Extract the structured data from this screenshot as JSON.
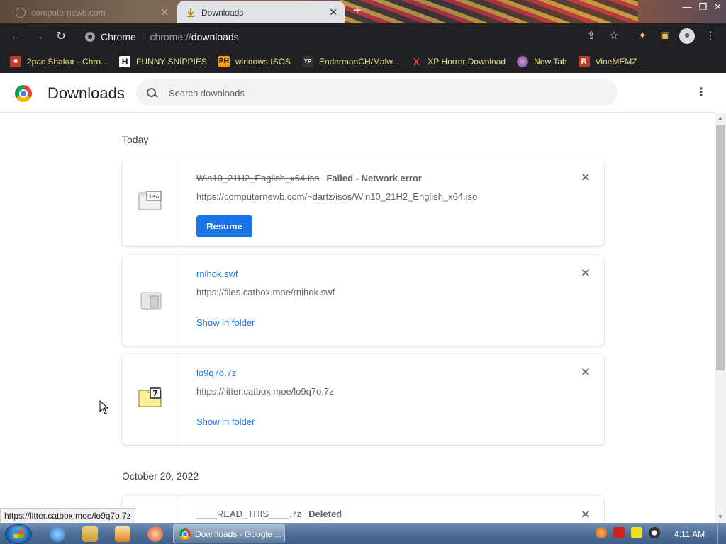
{
  "tabs": [
    {
      "title": "computernewb.com",
      "active": false
    },
    {
      "title": "Downloads",
      "active": true
    }
  ],
  "toolbar": {
    "omnibox_label": "Chrome",
    "url_host": "chrome://",
    "url_path": "downloads"
  },
  "bookmarks": [
    {
      "label": "2pac Shakur - Chro...",
      "icon": "briefcase-icon",
      "icon_text": "",
      "color": "#c0392b"
    },
    {
      "label": "FUNNY SNIPPIES",
      "icon": "h-logo-icon",
      "icon_text": "H",
      "color": "#ffffff"
    },
    {
      "label": "windows ISOS",
      "icon": "ph-logo-icon",
      "icon_text": "PH",
      "color": "#f39c12"
    },
    {
      "label": "EndermanCH/Malw...",
      "icon": "yp-logo-icon",
      "icon_text": "YP",
      "color": "#333333"
    },
    {
      "label": "XP Horror Download",
      "icon": "x-logo-icon",
      "icon_text": "X",
      "color": "#e74c3c"
    },
    {
      "label": "New Tab",
      "icon": "globe-icon",
      "icon_text": "",
      "color": "#9b59b6"
    },
    {
      "label": "VineMEMZ",
      "icon": "r-logo-icon",
      "icon_text": "R",
      "color": "#c0392b"
    }
  ],
  "header": {
    "title": "Downloads",
    "search_placeholder": "Search downloads"
  },
  "sections": [
    {
      "label": "Today"
    },
    {
      "label": "October 20, 2022"
    }
  ],
  "downloads": [
    {
      "filename": "Win10_21H2_English_x64.iso",
      "status": "Failed - Network error",
      "url": "https://computernewb.com/~dartz/isos/Win10_21H2_English_x64.iso",
      "action": "Resume"
    },
    {
      "filename": "rnihok.swf",
      "url": "https://files.catbox.moe/rnihok.swf",
      "action": "Show in folder"
    },
    {
      "filename": "lo9q7o.7z",
      "url": "https://litter.catbox.moe/lo9q7o.7z",
      "action": "Show in folder"
    },
    {
      "filename": "____READ_THIS____.7z",
      "status": "Deleted"
    }
  ],
  "status_bubble": "https://litter.catbox.moe/lo9q7o.7z",
  "taskbar": {
    "active_task": "Downloads - Google ...",
    "clock": "4:11 AM"
  },
  "colors": {
    "accent": "#1a73e8",
    "bookmark_text": "#f2e38a",
    "toolbar_bg": "#202124"
  }
}
